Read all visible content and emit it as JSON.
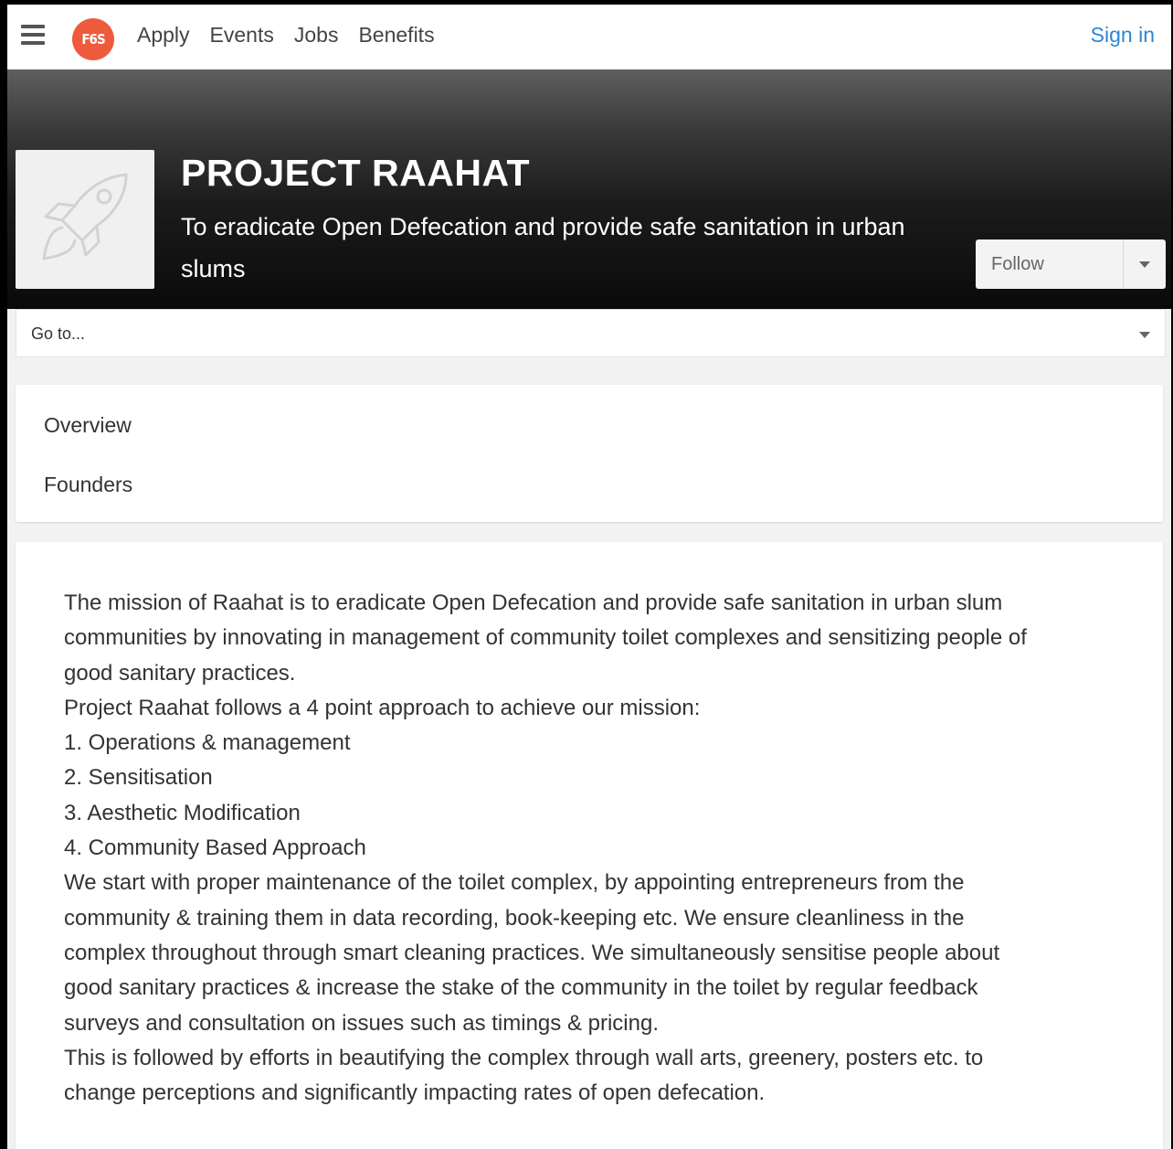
{
  "nav": {
    "logo_text": "F6S",
    "links": [
      "Apply",
      "Events",
      "Jobs",
      "Benefits"
    ],
    "sign_in": "Sign in"
  },
  "hero": {
    "title": "PROJECT RAAHAT",
    "subtitle": "To eradicate Open Defecation and provide safe sanitation in urban slums",
    "avatar_icon": "rocket-icon",
    "follow_label": "Follow"
  },
  "goto": {
    "label": "Go to..."
  },
  "menu": {
    "items": [
      "Overview",
      "Founders"
    ]
  },
  "content": {
    "lines": [
      "The mission of Raahat is to eradicate Open Defecation and provide safe sanitation in urban slum",
      "communities by innovating in management of community toilet complexes and sensitizing people of",
      "good sanitary practices.",
      "Project Raahat follows a 4 point approach to achieve our mission:",
      "1. Operations & management",
      "2. Sensitisation",
      "3. Aesthetic Modification",
      "4. Community Based Approach",
      "We start with proper maintenance of the toilet complex, by appointing entrepreneurs from the",
      "community & training them in data recording, book-keeping etc. We ensure cleanliness in the",
      "complex throughout through smart cleaning practices. We simultaneously sensitise people about",
      "good sanitary practices & increase the stake of the community in the toilet by regular feedback",
      "surveys and consultation on issues such as timings & pricing.",
      "This is followed by efforts in beautifying the complex through wall arts, greenery, posters etc. to",
      "change perceptions and significantly impacting rates of open defecation."
    ]
  },
  "colors": {
    "logo_bg": "#ee5b3c",
    "link_blue": "#2b87d8",
    "page_bg": "#f2f2f2"
  }
}
